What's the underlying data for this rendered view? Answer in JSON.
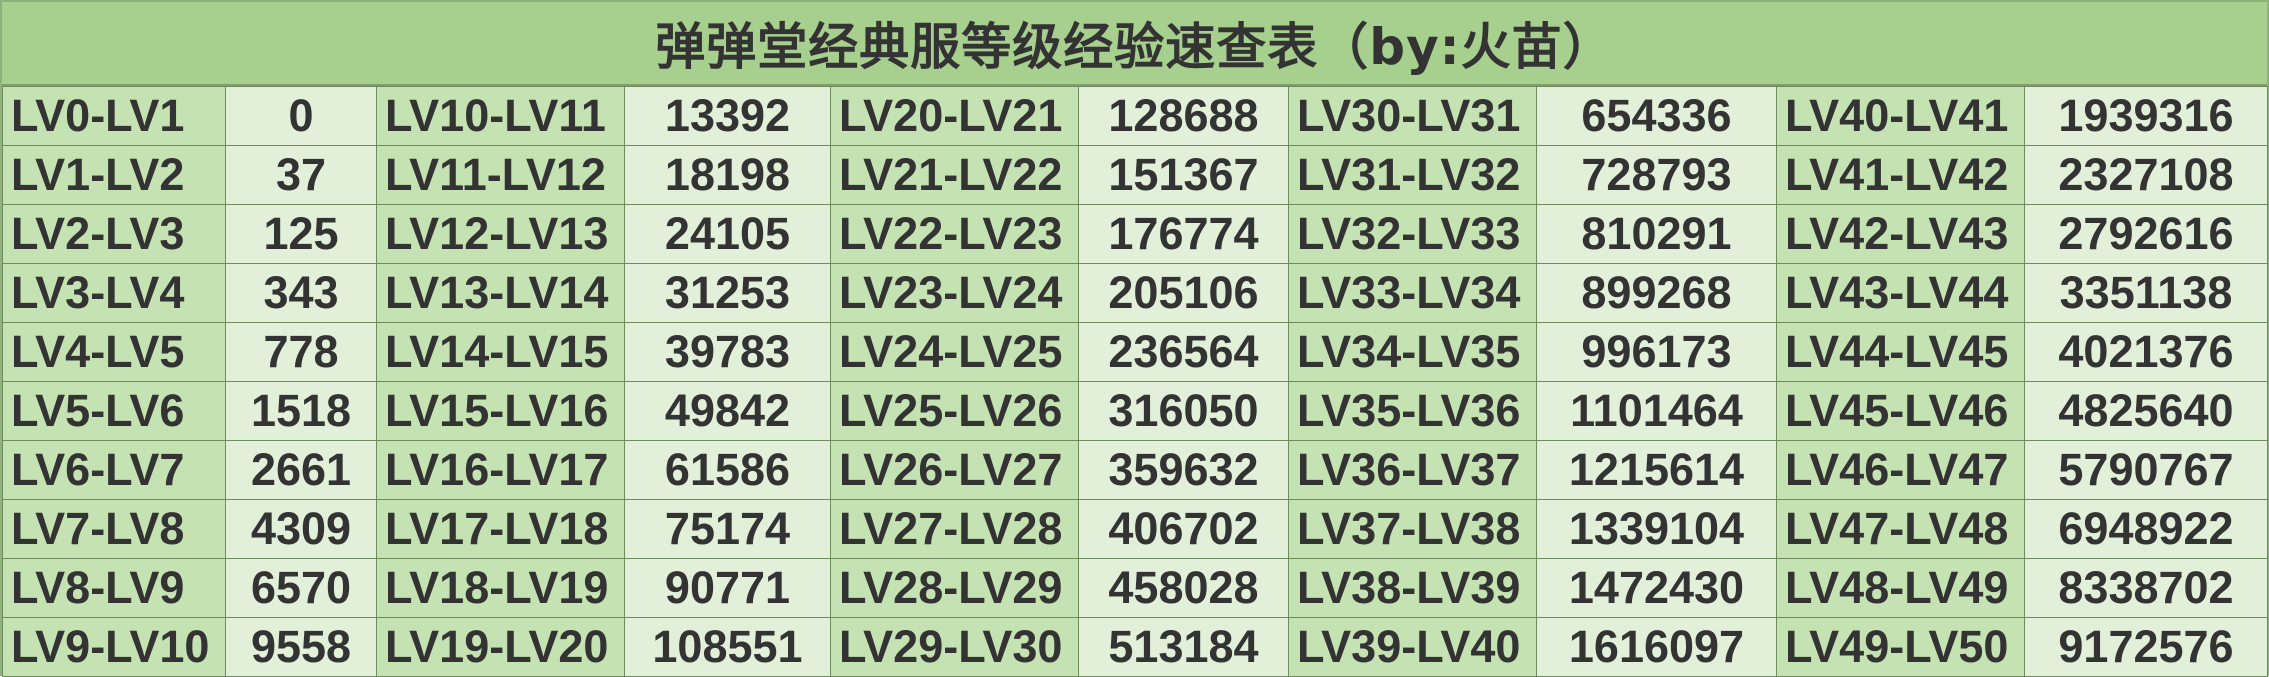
{
  "title": "弹弹堂经典服等级经验速查表（by:火苗）",
  "colors": {
    "title_bg": "#a7d08e",
    "level_cell_bg": "#c5e2b3",
    "value_cell_bg": "#e2f0d9",
    "text": "#333333",
    "grid_line": "#6f8a5f"
  },
  "columns": [
    {
      "levels": [
        "LV0-LV1",
        "LV1-LV2",
        "LV2-LV3",
        "LV3-LV4",
        "LV4-LV5",
        "LV5-LV6",
        "LV6-LV7",
        "LV7-LV8",
        "LV8-LV9",
        "LV9-LV10"
      ],
      "values": [
        "0",
        "37",
        "125",
        "343",
        "778",
        "1518",
        "2661",
        "4309",
        "6570",
        "9558"
      ]
    },
    {
      "levels": [
        "LV10-LV11",
        "LV11-LV12",
        "LV12-LV13",
        "LV13-LV14",
        "LV14-LV15",
        "LV15-LV16",
        "LV16-LV17",
        "LV17-LV18",
        "LV18-LV19",
        "LV19-LV20"
      ],
      "values": [
        "13392",
        "18198",
        "24105",
        "31253",
        "39783",
        "49842",
        "61586",
        "75174",
        "90771",
        "108551"
      ]
    },
    {
      "levels": [
        "LV20-LV21",
        "LV21-LV22",
        "LV22-LV23",
        "LV23-LV24",
        "LV24-LV25",
        "LV25-LV26",
        "LV26-LV27",
        "LV27-LV28",
        "LV28-LV29",
        "LV29-LV30"
      ],
      "values": [
        "128688",
        "151367",
        "176774",
        "205106",
        "236564",
        "316050",
        "359632",
        "406702",
        "458028",
        "513184"
      ]
    },
    {
      "levels": [
        "LV30-LV31",
        "LV31-LV32",
        "LV32-LV33",
        "LV33-LV34",
        "LV34-LV35",
        "LV35-LV36",
        "LV36-LV37",
        "LV37-LV38",
        "LV38-LV39",
        "LV39-LV40"
      ],
      "values": [
        "654336",
        "728793",
        "810291",
        "899268",
        "996173",
        "1101464",
        "1215614",
        "1339104",
        "1472430",
        "1616097"
      ]
    },
    {
      "levels": [
        "LV40-LV41",
        "LV41-LV42",
        "LV42-LV43",
        "LV43-LV44",
        "LV44-LV45",
        "LV45-LV46",
        "LV46-LV47",
        "LV47-LV48",
        "LV48-LV49",
        "LV49-LV50"
      ],
      "values": [
        "1939316",
        "2327108",
        "2792616",
        "3351138",
        "4021376",
        "4825640",
        "5790767",
        "6948922",
        "8338702",
        "9172576"
      ]
    }
  ]
}
